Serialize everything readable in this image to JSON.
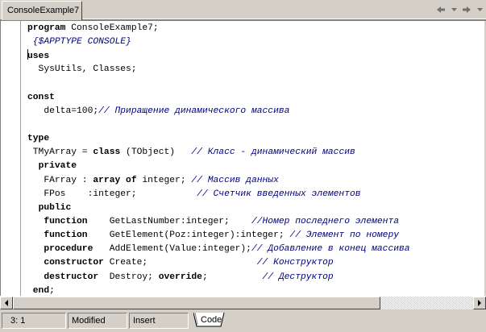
{
  "tabs": [
    {
      "label": "ConsoleExample7",
      "active": true
    }
  ],
  "nav": {
    "back_icon": "arrow-left-icon",
    "menu_icon": "dropdown-arrow-icon",
    "forward_icon": "arrow-right-icon"
  },
  "colors": {
    "comment": "#000080",
    "background": "#ffffff",
    "chrome": "#d4d0c8"
  },
  "code_lines": [
    [
      {
        "t": "program",
        "s": "kw"
      },
      {
        "t": " ConsoleExample7;",
        "s": "n"
      }
    ],
    [
      {
        "t": " {$APPTYPE CONSOLE}",
        "s": "cm"
      }
    ],
    [
      {
        "t": "|",
        "s": "cursor"
      },
      {
        "t": "uses",
        "s": "kw"
      }
    ],
    [
      {
        "t": "  SysUtils, Classes;",
        "s": "n"
      }
    ],
    [],
    [
      {
        "t": "const",
        "s": "kw"
      }
    ],
    [
      {
        "t": "   delta=100;",
        "s": "n"
      },
      {
        "t": "// Приращение динамического массива",
        "s": "cm"
      }
    ],
    [],
    [
      {
        "t": "type",
        "s": "kw"
      }
    ],
    [
      {
        "t": " TMyArray = ",
        "s": "n"
      },
      {
        "t": "class",
        "s": "kw"
      },
      {
        "t": " (TObject)   ",
        "s": "n"
      },
      {
        "t": "// Класс - динамический массив",
        "s": "cm"
      }
    ],
    [
      {
        "t": "  ",
        "s": "n"
      },
      {
        "t": "private",
        "s": "kw"
      }
    ],
    [
      {
        "t": "   FArray : ",
        "s": "n"
      },
      {
        "t": "array of",
        "s": "kw"
      },
      {
        "t": " integer; ",
        "s": "n"
      },
      {
        "t": "// Массив данных",
        "s": "cm"
      }
    ],
    [
      {
        "t": "   FPos    :integer;           ",
        "s": "n"
      },
      {
        "t": "// Счетчик введенных элементов",
        "s": "cm"
      }
    ],
    [
      {
        "t": "  ",
        "s": "n"
      },
      {
        "t": "public",
        "s": "kw"
      }
    ],
    [
      {
        "t": "   ",
        "s": "n"
      },
      {
        "t": "function",
        "s": "kw"
      },
      {
        "t": "    GetLastNumber:integer;    ",
        "s": "n"
      },
      {
        "t": "//Номер последнего элемента",
        "s": "cm"
      }
    ],
    [
      {
        "t": "   ",
        "s": "n"
      },
      {
        "t": "function",
        "s": "kw"
      },
      {
        "t": "    GetElement(Poz:integer):integer; ",
        "s": "n"
      },
      {
        "t": "// Элемент по номеру",
        "s": "cm"
      }
    ],
    [
      {
        "t": "   ",
        "s": "n"
      },
      {
        "t": "procedure",
        "s": "kw"
      },
      {
        "t": "   AddElement(Value:integer);",
        "s": "n"
      },
      {
        "t": "// Добавление в конец массива",
        "s": "cm"
      }
    ],
    [
      {
        "t": "   ",
        "s": "n"
      },
      {
        "t": "constructor",
        "s": "kw"
      },
      {
        "t": " Create;                    ",
        "s": "n"
      },
      {
        "t": "// Конструктор",
        "s": "cm"
      }
    ],
    [
      {
        "t": "   ",
        "s": "n"
      },
      {
        "t": "destructor",
        "s": "kw"
      },
      {
        "t": "  Destroy; ",
        "s": "n"
      },
      {
        "t": "override",
        "s": "kw"
      },
      {
        "t": ";          ",
        "s": "n"
      },
      {
        "t": "// Деструктор",
        "s": "cm"
      }
    ],
    [
      {
        "t": " ",
        "s": "n"
      },
      {
        "t": "end",
        "s": "kw"
      },
      {
        "t": ";",
        "s": "n"
      }
    ]
  ],
  "statusbar": {
    "position": "3:  1",
    "modified": "Modified",
    "mode": "Insert",
    "view_tab": "Code"
  }
}
